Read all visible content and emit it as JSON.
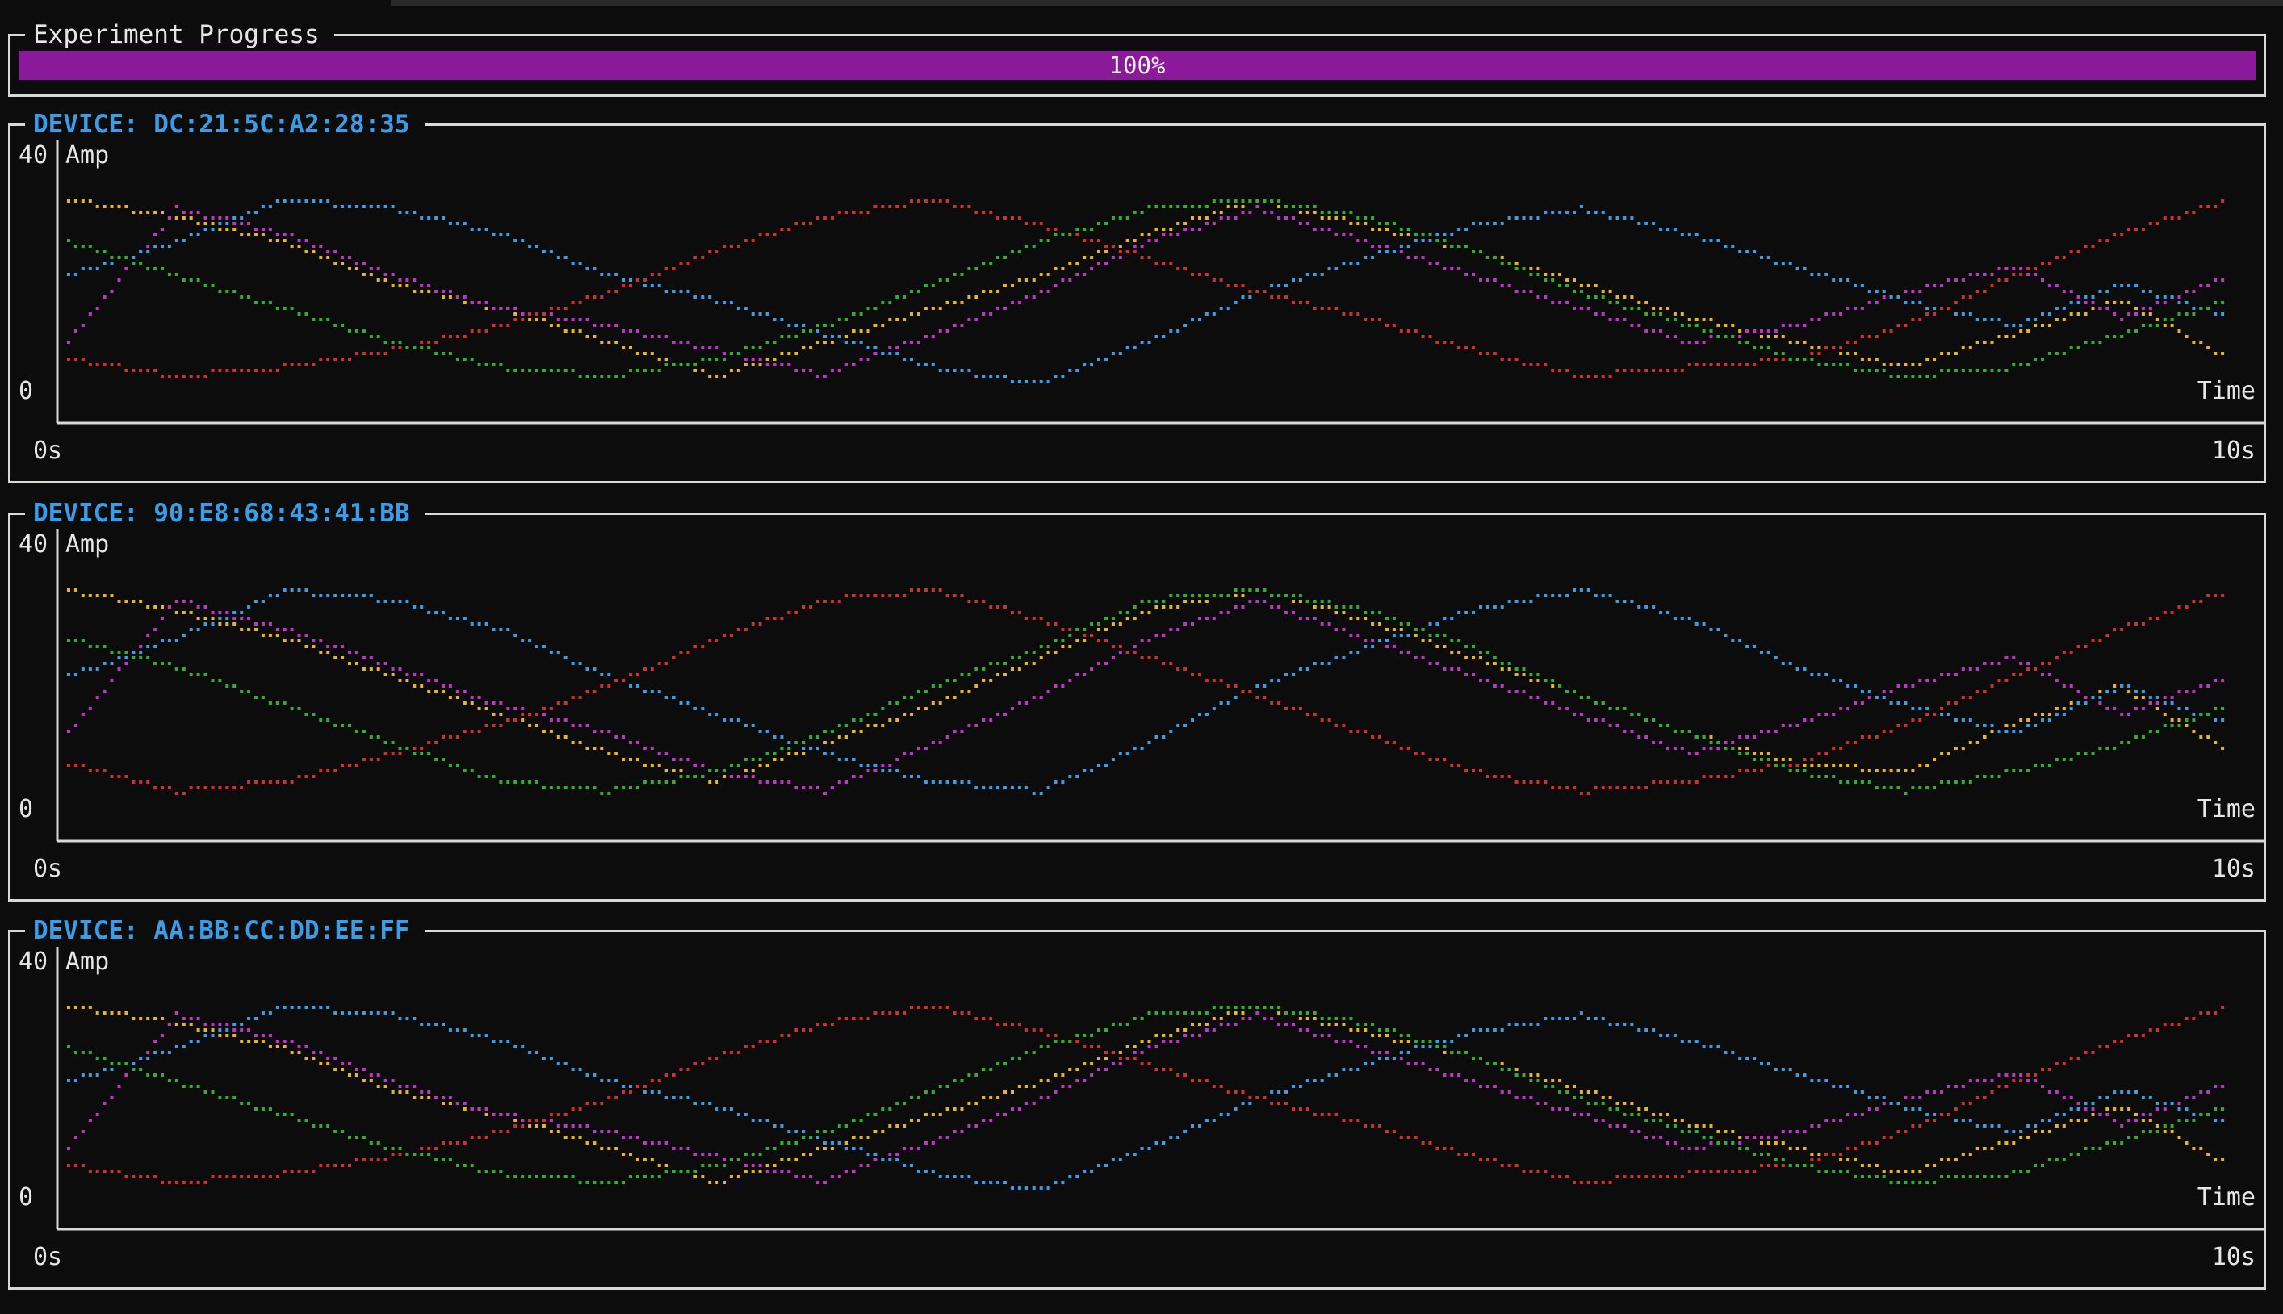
{
  "progress": {
    "title": "Experiment Progress",
    "value": 1.0,
    "label": "100%",
    "color": "#8b1a9a"
  },
  "colors": {
    "background": "#0c0c0c",
    "border": "#d8d8d8",
    "device_title": "#3b9ce8",
    "series": [
      "#e8b422",
      "#c034c9",
      "#3b9ce8",
      "#d32f2f",
      "#2fb02f"
    ]
  },
  "devices": [
    {
      "title": "DEVICE: DC:21:5C:A2:28:35",
      "chart_data": {
        "type": "scatter",
        "ylabel": "Amp",
        "xlabel": "Time",
        "ylim": [
          0,
          40
        ],
        "xlim": [
          0,
          10
        ],
        "y_tick_labels": [
          "40",
          "0"
        ],
        "x_tick_labels": [
          "0s",
          "10s"
        ],
        "series": [
          {
            "color": "#e8b422",
            "x": [
              0.0,
              0.5,
              1.0,
              1.5,
              2.0,
              2.5,
              3.0,
              3.5,
              4.0,
              4.5,
              5.0,
              5.5,
              6.0,
              6.5,
              7.0,
              7.5,
              8.0,
              8.5,
              9.0,
              9.5,
              10.0
            ],
            "y": [
              31,
              29,
              26,
              21,
              18,
              14,
              10,
              14,
              18,
              22,
              27,
              31,
              28,
              25,
              21,
              17,
              14,
              11,
              15,
              19,
              12
            ]
          },
          {
            "color": "#c034c9",
            "x": [
              0.0,
              0.5,
              1.0,
              1.5,
              2.0,
              2.5,
              3.0,
              3.5,
              4.0,
              4.5,
              5.0,
              5.5,
              6.0,
              6.5,
              7.0,
              7.5,
              8.0,
              8.5,
              9.0,
              9.5,
              10.0
            ],
            "y": [
              14,
              30,
              27,
              22,
              18,
              16,
              13,
              10,
              15,
              20,
              26,
              30,
              26,
              22,
              18,
              14,
              16,
              20,
              23,
              17,
              22
            ]
          },
          {
            "color": "#3b9ce8",
            "x": [
              0.0,
              0.5,
              1.0,
              1.5,
              2.0,
              2.5,
              3.0,
              3.5,
              4.0,
              4.5,
              5.0,
              5.5,
              6.0,
              6.5,
              7.0,
              7.5,
              8.0,
              8.5,
              9.0,
              9.5,
              10.0
            ],
            "y": [
              22,
              26,
              31,
              30,
              27,
              22,
              19,
              15,
              11,
              9,
              14,
              20,
              24,
              28,
              30,
              27,
              23,
              19,
              16,
              21,
              17
            ]
          },
          {
            "color": "#d32f2f",
            "x": [
              0.0,
              0.5,
              1.0,
              1.5,
              2.0,
              2.5,
              3.0,
              3.5,
              4.0,
              4.5,
              5.0,
              5.5,
              6.0,
              6.5,
              7.0,
              7.5,
              8.0,
              8.5,
              9.0,
              9.5,
              10.0
            ],
            "y": [
              12,
              10,
              11,
              13,
              16,
              20,
              25,
              29,
              31,
              28,
              24,
              20,
              17,
              13,
              10,
              11,
              12,
              16,
              22,
              27,
              31
            ]
          },
          {
            "color": "#2fb02f",
            "x": [
              0.0,
              0.5,
              1.0,
              1.5,
              2.0,
              2.5,
              3.0,
              3.5,
              4.0,
              4.5,
              5.0,
              5.5,
              6.0,
              6.5,
              7.0,
              7.5,
              8.0,
              8.5,
              9.0,
              9.5,
              10.0
            ],
            "y": [
              26,
              22,
              18,
              14,
              11,
              10,
              12,
              16,
              21,
              26,
              30,
              31,
              29,
              25,
              20,
              16,
              12,
              10,
              11,
              15,
              19
            ]
          }
        ]
      }
    },
    {
      "title": "DEVICE: 90:E8:68:43:41:BB",
      "chart_data": {
        "type": "scatter",
        "ylabel": "Amp",
        "xlabel": "Time",
        "ylim": [
          0,
          40
        ],
        "xlim": [
          0,
          10
        ],
        "y_tick_labels": [
          "40",
          "0"
        ],
        "x_tick_labels": [
          "0s",
          "10s"
        ],
        "series": [
          {
            "color": "#e8b422",
            "x": [
              0.0,
              0.5,
              1.0,
              1.5,
              2.0,
              2.5,
              3.0,
              3.5,
              4.0,
              4.5,
              5.0,
              5.5,
              6.0,
              6.5,
              7.0,
              7.5,
              8.0,
              8.5,
              9.0,
              9.5,
              10.0
            ],
            "y": [
              31,
              29,
              26,
              22,
              18,
              14,
              11,
              15,
              19,
              24,
              29,
              31,
              28,
              24,
              20,
              16,
              13,
              12,
              17,
              21,
              14
            ]
          },
          {
            "color": "#c034c9",
            "x": [
              0.0,
              0.5,
              1.0,
              1.5,
              2.0,
              2.5,
              3.0,
              3.5,
              4.0,
              4.5,
              5.0,
              5.5,
              6.0,
              6.5,
              7.0,
              7.5,
              8.0,
              8.5,
              9.0,
              9.5,
              10.0
            ],
            "y": [
              16,
              30,
              27,
              23,
              19,
              16,
              12,
              10,
              15,
              20,
              26,
              30,
              26,
              22,
              18,
              14,
              17,
              21,
              24,
              18,
              22
            ]
          },
          {
            "color": "#3b9ce8",
            "x": [
              0.0,
              0.5,
              1.0,
              1.5,
              2.0,
              2.5,
              3.0,
              3.5,
              4.0,
              4.5,
              5.0,
              5.5,
              6.0,
              6.5,
              7.0,
              7.5,
              8.0,
              8.5,
              9.0,
              9.5,
              10.0
            ],
            "y": [
              22,
              26,
              31,
              30,
              27,
              22,
              18,
              14,
              11,
              10,
              15,
              21,
              25,
              29,
              31,
              28,
              23,
              19,
              16,
              21,
              17
            ]
          },
          {
            "color": "#d32f2f",
            "x": [
              0.0,
              0.5,
              1.0,
              1.5,
              2.0,
              2.5,
              3.0,
              3.5,
              4.0,
              4.5,
              5.0,
              5.5,
              6.0,
              6.5,
              7.0,
              7.5,
              8.0,
              8.5,
              9.0,
              9.5,
              10.0
            ],
            "y": [
              13,
              10,
              11,
              14,
              17,
              21,
              26,
              30,
              31,
              28,
              24,
              20,
              16,
              12,
              10,
              11,
              13,
              17,
              22,
              27,
              31
            ]
          },
          {
            "color": "#2fb02f",
            "x": [
              0.0,
              0.5,
              1.0,
              1.5,
              2.0,
              2.5,
              3.0,
              3.5,
              4.0,
              4.5,
              5.0,
              5.5,
              6.0,
              6.5,
              7.0,
              7.5,
              8.0,
              8.5,
              9.0,
              9.5,
              10.0
            ],
            "y": [
              26,
              23,
              19,
              15,
              11,
              10,
              12,
              16,
              21,
              25,
              30,
              31,
              29,
              25,
              20,
              16,
              12,
              10,
              12,
              15,
              19
            ]
          }
        ]
      }
    },
    {
      "title": "DEVICE: AA:BB:CC:DD:EE:FF",
      "chart_data": {
        "type": "scatter",
        "ylabel": "Amp",
        "xlabel": "Time",
        "ylim": [
          0,
          40
        ],
        "xlim": [
          0,
          10
        ],
        "y_tick_labels": [
          "40",
          "0"
        ],
        "x_tick_labels": [
          "0s",
          "10s"
        ],
        "series": [
          {
            "color": "#e8b422",
            "x": [
              0.0,
              0.5,
              1.0,
              1.5,
              2.0,
              2.5,
              3.0,
              3.5,
              4.0,
              4.5,
              5.0,
              5.5,
              6.0,
              6.5,
              7.0,
              7.5,
              8.0,
              8.5,
              9.0,
              9.5,
              10.0
            ],
            "y": [
              31,
              29,
              26,
              21,
              18,
              14,
              10,
              14,
              18,
              22,
              27,
              31,
              28,
              25,
              21,
              17,
              14,
              11,
              15,
              19,
              12
            ]
          },
          {
            "color": "#c034c9",
            "x": [
              0.0,
              0.5,
              1.0,
              1.5,
              2.0,
              2.5,
              3.0,
              3.5,
              4.0,
              4.5,
              5.0,
              5.5,
              6.0,
              6.5,
              7.0,
              7.5,
              8.0,
              8.5,
              9.0,
              9.5,
              10.0
            ],
            "y": [
              14,
              30,
              27,
              22,
              18,
              16,
              13,
              10,
              15,
              20,
              26,
              30,
              26,
              22,
              18,
              14,
              16,
              20,
              23,
              17,
              22
            ]
          },
          {
            "color": "#3b9ce8",
            "x": [
              0.0,
              0.5,
              1.0,
              1.5,
              2.0,
              2.5,
              3.0,
              3.5,
              4.0,
              4.5,
              5.0,
              5.5,
              6.0,
              6.5,
              7.0,
              7.5,
              8.0,
              8.5,
              9.0,
              9.5,
              10.0
            ],
            "y": [
              22,
              26,
              31,
              30,
              27,
              22,
              19,
              15,
              11,
              9,
              14,
              20,
              24,
              28,
              30,
              27,
              23,
              19,
              16,
              21,
              17
            ]
          },
          {
            "color": "#d32f2f",
            "x": [
              0.0,
              0.5,
              1.0,
              1.5,
              2.0,
              2.5,
              3.0,
              3.5,
              4.0,
              4.5,
              5.0,
              5.5,
              6.0,
              6.5,
              7.0,
              7.5,
              8.0,
              8.5,
              9.0,
              9.5,
              10.0
            ],
            "y": [
              12,
              10,
              11,
              13,
              16,
              20,
              25,
              29,
              31,
              28,
              24,
              20,
              17,
              13,
              10,
              11,
              12,
              16,
              22,
              27,
              31
            ]
          },
          {
            "color": "#2fb02f",
            "x": [
              0.0,
              0.5,
              1.0,
              1.5,
              2.0,
              2.5,
              3.0,
              3.5,
              4.0,
              4.5,
              5.0,
              5.5,
              6.0,
              6.5,
              7.0,
              7.5,
              8.0,
              8.5,
              9.0,
              9.5,
              10.0
            ],
            "y": [
              26,
              22,
              18,
              14,
              11,
              10,
              12,
              16,
              21,
              26,
              30,
              31,
              29,
              25,
              20,
              16,
              12,
              10,
              11,
              15,
              19
            ]
          }
        ]
      }
    }
  ]
}
